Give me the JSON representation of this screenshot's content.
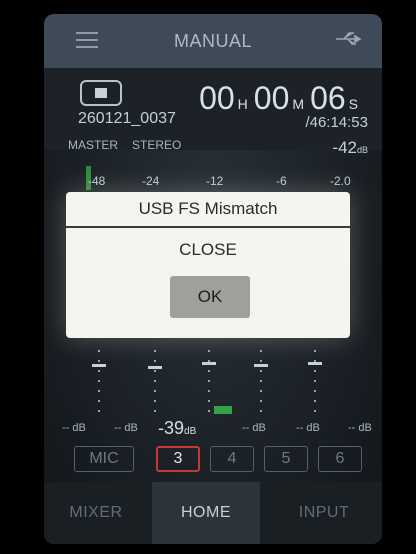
{
  "header": {
    "title": "MANUAL"
  },
  "status": {
    "time": {
      "hours": "00",
      "hours_unit": "H",
      "minutes": "00",
      "minutes_unit": "M",
      "seconds": "06",
      "seconds_unit": "S"
    },
    "file_name": "260121_0037",
    "remaining": "/46:14:53"
  },
  "meter": {
    "label_left": "MASTER",
    "label_mode": "STEREO",
    "level_value": "-42",
    "level_unit": "dB",
    "scale": [
      "-48",
      "-24",
      "-12",
      "-6",
      "-2.0"
    ],
    "level_fraction": 0.06
  },
  "dialog": {
    "title": "USB FS Mismatch",
    "message": "CLOSE",
    "ok_label": "OK"
  },
  "faders": {
    "db_labels": [
      "-- dB",
      "-- dB",
      "-- dB",
      "-- dB",
      "-- dB"
    ],
    "selected_value": "-39",
    "selected_unit": "dB"
  },
  "channels": [
    {
      "label": "MIC",
      "active": false
    },
    {
      "label": "3",
      "active": true
    },
    {
      "label": "4",
      "active": false
    },
    {
      "label": "5",
      "active": false
    },
    {
      "label": "6",
      "active": false
    }
  ],
  "nav": {
    "mixer": "MIXER",
    "home": "HOME",
    "input": "INPUT"
  },
  "colors": {
    "accent_red": "#c23a36",
    "meter_green": "#34a346",
    "dialog_bg": "#f4f5ef"
  }
}
